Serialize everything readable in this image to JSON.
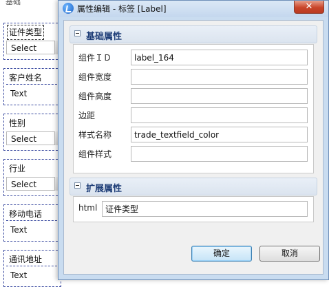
{
  "designer": {
    "cut_label": "基础",
    "fields": [
      {
        "label": "证件类型",
        "control": "Select",
        "selected": true
      },
      {
        "label": "客户姓名",
        "control": "Text",
        "selected": false
      },
      {
        "label": "性别",
        "control": "Select",
        "selected": false
      },
      {
        "label": "行业",
        "control": "Select",
        "selected": false
      },
      {
        "label": "移动电话",
        "control": "Text",
        "selected": false
      },
      {
        "label": "通讯地址",
        "control": "Text",
        "selected": false
      }
    ]
  },
  "dialog": {
    "title": "属性编辑 - 标签 [Label]",
    "close_symbol": "✕",
    "basic_section": {
      "title": "基础属性",
      "rows": [
        {
          "label": "组件ＩＤ",
          "value": "label_164"
        },
        {
          "label": "组件宽度",
          "value": ""
        },
        {
          "label": "组件高度",
          "value": ""
        },
        {
          "label": "边距",
          "value": ""
        },
        {
          "label": "样式名称",
          "value": "trade_textfield_color"
        },
        {
          "label": "组件样式",
          "value": ""
        }
      ]
    },
    "ext_section": {
      "title": "扩展属性",
      "html_label": "html",
      "html_value": "证件类型"
    },
    "ok_label": "确定",
    "cancel_label": "取消"
  },
  "colors": {
    "section_title": "#1f3e78",
    "close_button": "#c9452a",
    "field_border": "#3a4aa0"
  }
}
